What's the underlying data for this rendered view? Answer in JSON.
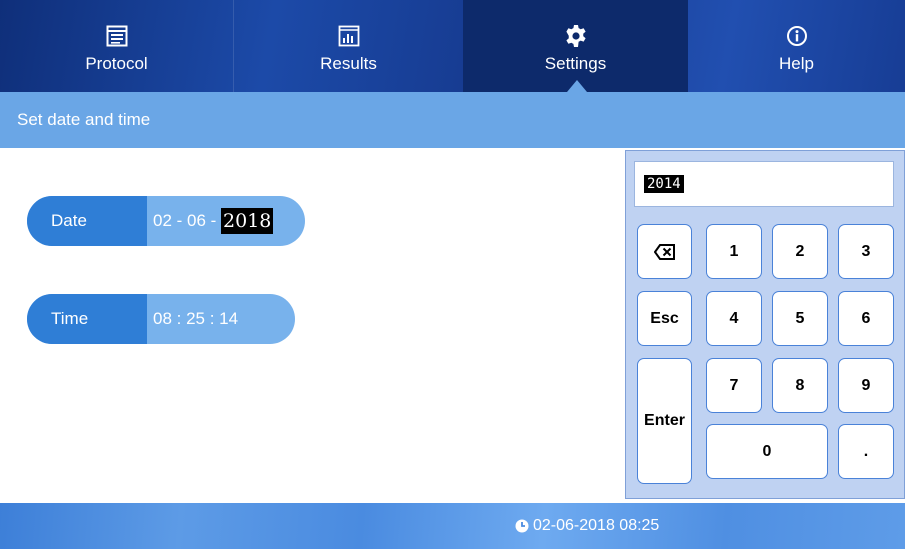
{
  "nav": {
    "tabs": [
      {
        "label": "Protocol",
        "icon": "protocol-icon"
      },
      {
        "label": "Results",
        "icon": "results-icon"
      },
      {
        "label": "Settings",
        "icon": "gear-icon",
        "active": true
      },
      {
        "label": "Help",
        "icon": "info-icon"
      }
    ]
  },
  "page": {
    "title": "Set date and time"
  },
  "fields": {
    "date": {
      "label": "Date",
      "prefix": "02 - 06 - ",
      "selected": "2018"
    },
    "time": {
      "label": "Time",
      "value": "08 : 25 : 14"
    }
  },
  "keypad": {
    "display": "2014",
    "keys": {
      "backspace": "⌫",
      "esc": "Esc",
      "enter": "Enter",
      "k1": "1",
      "k2": "2",
      "k3": "3",
      "k4": "4",
      "k5": "5",
      "k6": "6",
      "k7": "7",
      "k8": "8",
      "k9": "9",
      "k0": "0",
      "dot": "."
    }
  },
  "footer": {
    "datetime": "02-06-2018 08:25",
    "icon": "clock-icon"
  },
  "colors": {
    "nav": "#163a8f",
    "accent": "#6aa6e6",
    "pill_label": "#2f7ed6",
    "pill_value": "#78b2ec"
  }
}
